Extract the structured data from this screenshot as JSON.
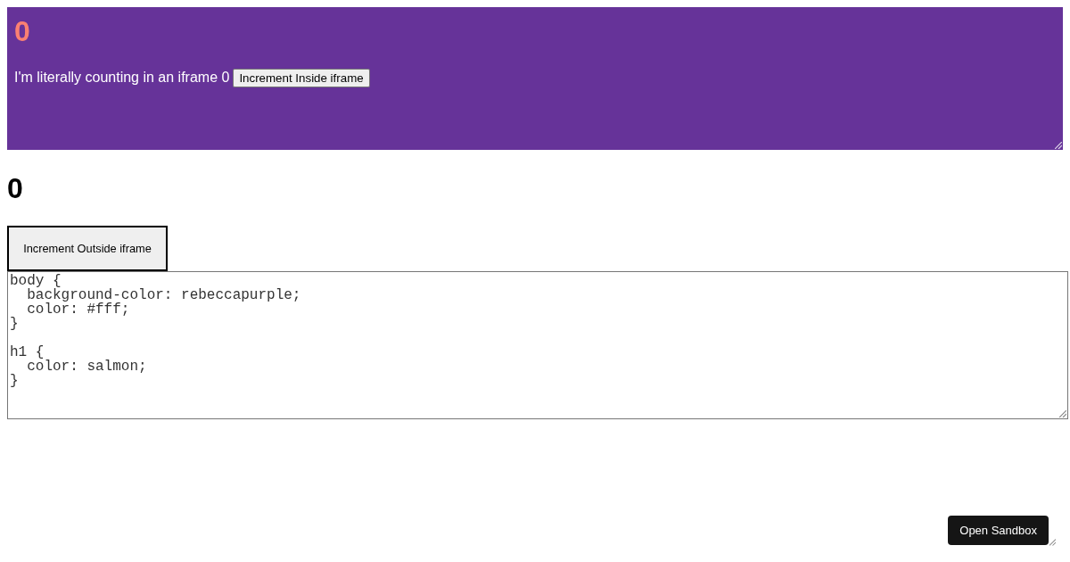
{
  "iframe": {
    "heading": "0",
    "text": "I'm literally counting in an iframe 0",
    "button": "Increment Inside iframe"
  },
  "heading": "0",
  "outside_button": "Increment Outside iframe",
  "css_editor": {
    "value": "body {\n  background-color: rebeccapurple;\n  color: #fff;\n}\n\nh1 {\n  color: salmon;\n}"
  },
  "open_sandbox_button": "Open Sandbox"
}
